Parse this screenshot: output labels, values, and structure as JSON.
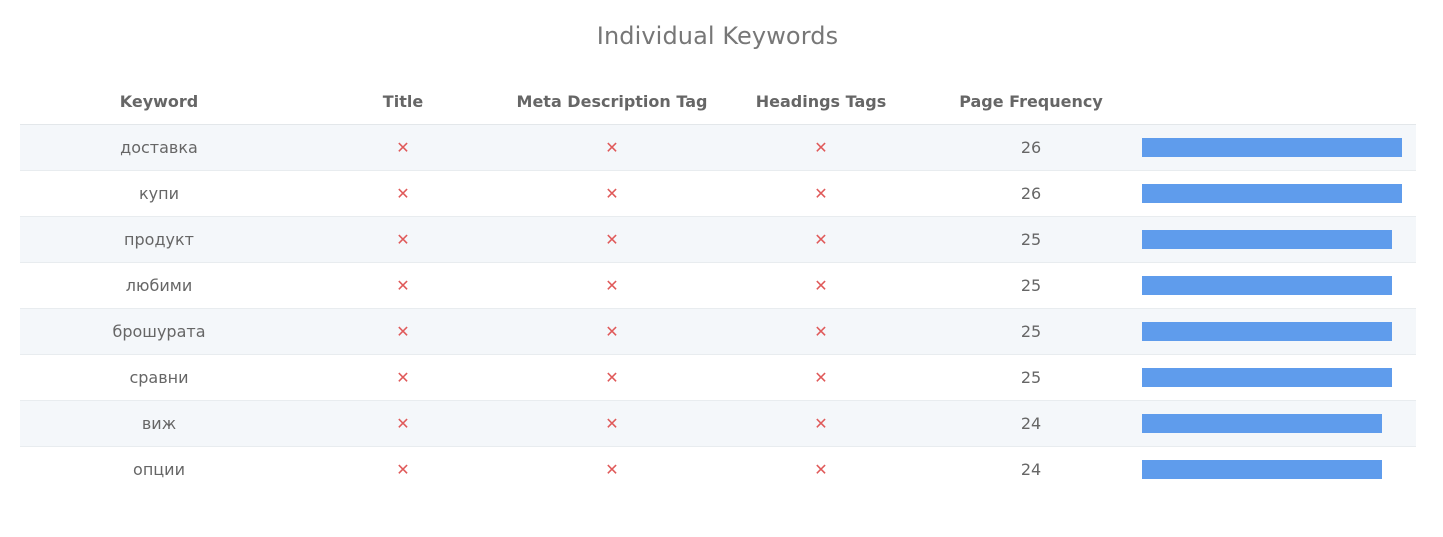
{
  "title": "Individual Keywords",
  "columns": {
    "keyword": "Keyword",
    "title": "Title",
    "meta": "Meta Description Tag",
    "headings": "Headings Tags",
    "frequency": "Page Frequency"
  },
  "status_icon": "x-mark-icon",
  "colors": {
    "bar": "#5f9cec",
    "x_mark": "#e05a5a",
    "row_stripe": "#f4f7fa"
  },
  "rows": [
    {
      "keyword": "доставка",
      "title": "✕",
      "meta": "✕",
      "headings": "✕",
      "frequency": "26"
    },
    {
      "keyword": "купи",
      "title": "✕",
      "meta": "✕",
      "headings": "✕",
      "frequency": "26"
    },
    {
      "keyword": "продукт",
      "title": "✕",
      "meta": "✕",
      "headings": "✕",
      "frequency": "25"
    },
    {
      "keyword": "любими",
      "title": "✕",
      "meta": "✕",
      "headings": "✕",
      "frequency": "25"
    },
    {
      "keyword": "брошурата",
      "title": "✕",
      "meta": "✕",
      "headings": "✕",
      "frequency": "25"
    },
    {
      "keyword": "сравни",
      "title": "✕",
      "meta": "✕",
      "headings": "✕",
      "frequency": "25"
    },
    {
      "keyword": "виж",
      "title": "✕",
      "meta": "✕",
      "headings": "✕",
      "frequency": "24"
    },
    {
      "keyword": "опции",
      "title": "✕",
      "meta": "✕",
      "headings": "✕",
      "frequency": "24"
    }
  ]
}
